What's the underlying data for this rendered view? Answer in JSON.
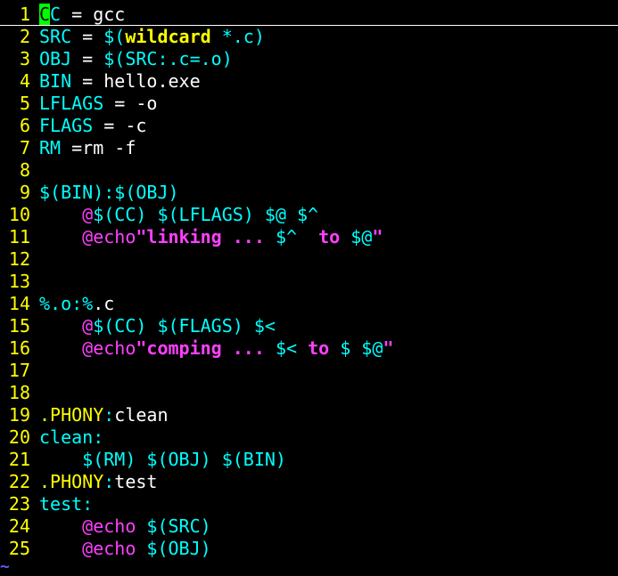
{
  "colors": {
    "background": "#000000",
    "line_number": "#ffff00",
    "identifier": "#00ffff",
    "text": "#ffffff",
    "statement": "#ff40ff",
    "special": "#ffff00",
    "cursor": "#00ff00",
    "nontext": "#5c5cff"
  },
  "editor": {
    "tilde": "~",
    "lines": [
      {
        "num": "1",
        "segments": [
          {
            "t": "C",
            "c": "cursor"
          },
          {
            "t": "C",
            "c": "identifier"
          },
          {
            "t": " = gcc",
            "c": "text"
          }
        ]
      },
      {
        "num": "2",
        "segments": [
          {
            "t": "SRC",
            "c": "identifier"
          },
          {
            "t": " = ",
            "c": "text"
          },
          {
            "t": "$(",
            "c": "identifier"
          },
          {
            "t": "wildcard",
            "c": "special",
            "b": true
          },
          {
            "t": " *.c)",
            "c": "identifier"
          }
        ]
      },
      {
        "num": "3",
        "segments": [
          {
            "t": "OBJ",
            "c": "identifier"
          },
          {
            "t": " = ",
            "c": "text"
          },
          {
            "t": "$(SRC:.c=.o)",
            "c": "identifier"
          }
        ]
      },
      {
        "num": "4",
        "segments": [
          {
            "t": "BIN",
            "c": "identifier"
          },
          {
            "t": " = hello.exe",
            "c": "text"
          }
        ]
      },
      {
        "num": "5",
        "segments": [
          {
            "t": "LFLAGS",
            "c": "identifier"
          },
          {
            "t": " = -o",
            "c": "text"
          }
        ]
      },
      {
        "num": "6",
        "segments": [
          {
            "t": "FLAGS",
            "c": "identifier"
          },
          {
            "t": " = -c",
            "c": "text"
          }
        ]
      },
      {
        "num": "7",
        "segments": [
          {
            "t": "RM",
            "c": "identifier"
          },
          {
            "t": " =rm -f",
            "c": "text"
          }
        ]
      },
      {
        "num": "8",
        "segments": []
      },
      {
        "num": "9",
        "segments": [
          {
            "t": "$(BIN):$(OBJ)",
            "c": "identifier"
          }
        ]
      },
      {
        "num": "10",
        "segments": [
          {
            "t": "    ",
            "c": "text"
          },
          {
            "t": "@",
            "c": "statement"
          },
          {
            "t": "$(CC) $(LFLAGS) $@ $^",
            "c": "identifier"
          }
        ]
      },
      {
        "num": "11",
        "segments": [
          {
            "t": "    ",
            "c": "text"
          },
          {
            "t": "@echo",
            "c": "statement"
          },
          {
            "t": "\"linking ... ",
            "c": "statement",
            "b": true
          },
          {
            "t": "$^",
            "c": "identifier"
          },
          {
            "t": "  to ",
            "c": "statement",
            "b": true
          },
          {
            "t": "$@",
            "c": "identifier"
          },
          {
            "t": "\"",
            "c": "statement",
            "b": true
          }
        ]
      },
      {
        "num": "12",
        "segments": []
      },
      {
        "num": "13",
        "segments": []
      },
      {
        "num": "14",
        "segments": [
          {
            "t": "%.o:%",
            "c": "identifier"
          },
          {
            "t": ".c",
            "c": "text"
          }
        ]
      },
      {
        "num": "15",
        "segments": [
          {
            "t": "    ",
            "c": "text"
          },
          {
            "t": "@",
            "c": "statement"
          },
          {
            "t": "$(CC) $(FLAGS) $<",
            "c": "identifier"
          }
        ]
      },
      {
        "num": "16",
        "segments": [
          {
            "t": "    ",
            "c": "text"
          },
          {
            "t": "@echo",
            "c": "statement"
          },
          {
            "t": "\"comping ... ",
            "c": "statement",
            "b": true
          },
          {
            "t": "$<",
            "c": "identifier"
          },
          {
            "t": " to ",
            "c": "statement",
            "b": true
          },
          {
            "t": "$ $@",
            "c": "identifier"
          },
          {
            "t": "\"",
            "c": "statement",
            "b": true
          }
        ]
      },
      {
        "num": "17",
        "segments": []
      },
      {
        "num": "18",
        "segments": []
      },
      {
        "num": "19",
        "segments": [
          {
            "t": ".PHONY",
            "c": "special"
          },
          {
            "t": ":",
            "c": "identifier"
          },
          {
            "t": "clean",
            "c": "text"
          }
        ]
      },
      {
        "num": "20",
        "segments": [
          {
            "t": "clean:",
            "c": "identifier"
          }
        ]
      },
      {
        "num": "21",
        "segments": [
          {
            "t": "    ",
            "c": "text"
          },
          {
            "t": "$(RM) $(OBJ) $(BIN)",
            "c": "identifier"
          }
        ]
      },
      {
        "num": "22",
        "segments": [
          {
            "t": ".PHONY",
            "c": "special"
          },
          {
            "t": ":",
            "c": "identifier"
          },
          {
            "t": "test",
            "c": "text"
          }
        ]
      },
      {
        "num": "23",
        "segments": [
          {
            "t": "test:",
            "c": "identifier"
          }
        ]
      },
      {
        "num": "24",
        "segments": [
          {
            "t": "    ",
            "c": "text"
          },
          {
            "t": "@echo",
            "c": "statement"
          },
          {
            "t": " $(SRC)",
            "c": "identifier"
          }
        ]
      },
      {
        "num": "25",
        "segments": [
          {
            "t": "    ",
            "c": "text"
          },
          {
            "t": "@echo",
            "c": "statement"
          },
          {
            "t": " $(OBJ)",
            "c": "identifier"
          }
        ]
      }
    ]
  }
}
